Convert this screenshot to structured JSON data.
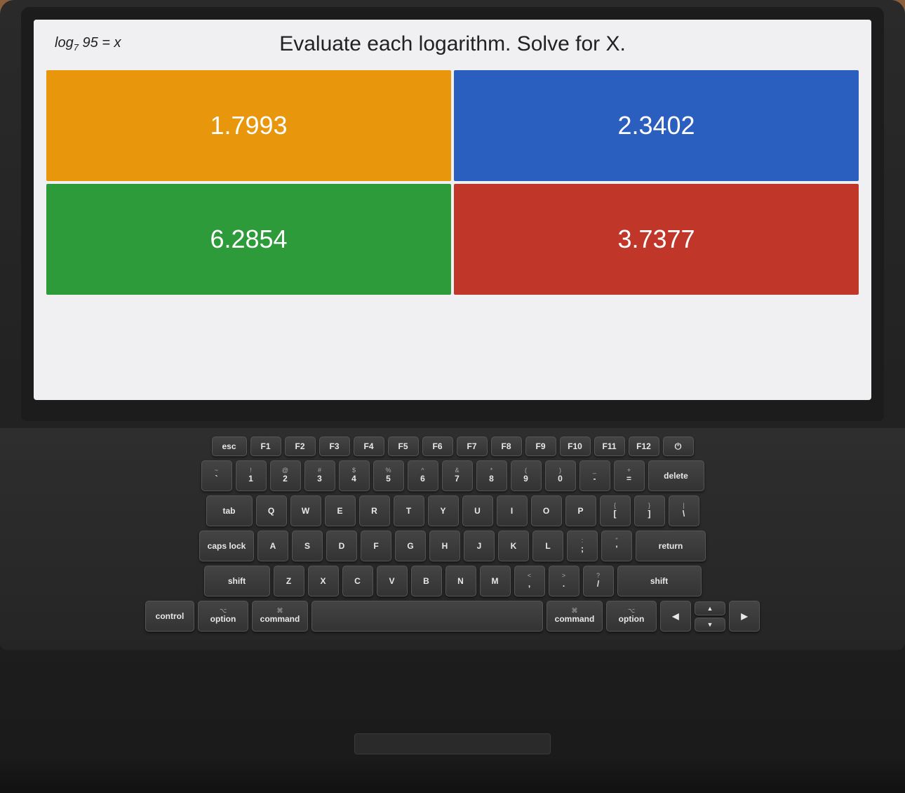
{
  "screen": {
    "math_expression": "log₇ 95 = x",
    "title": "Evaluate each logarithm. Solve for X.",
    "options": [
      {
        "id": "A",
        "value": "1.7993",
        "color_class": "option-orange",
        "color": "#E8960C"
      },
      {
        "id": "B",
        "value": "2.3402",
        "color_class": "option-blue",
        "color": "#2B5FBF"
      },
      {
        "id": "C",
        "value": "6.2854",
        "color_class": "option-green",
        "color": "#2E9B3A"
      },
      {
        "id": "D",
        "value": "3.7377",
        "color_class": "option-red",
        "color": "#C0372A"
      }
    ]
  },
  "keyboard": {
    "fn_row": [
      "esc",
      "F1",
      "F2",
      "F3",
      "F4",
      "F5",
      "F6",
      "F7",
      "F8",
      "F9",
      "F10",
      "F11",
      "F12",
      ""
    ],
    "row1": [
      "~\n`",
      "!\n1",
      "@\n2",
      "#\n3",
      "$\n4",
      "%\n5",
      "^\n6",
      "&\n7",
      "*\n8",
      "(\n9",
      ")\n0",
      "_\n-",
      "+\n=",
      "delete"
    ],
    "row2": [
      "tab",
      "Q",
      "W",
      "E",
      "R",
      "T",
      "Y",
      "U",
      "I",
      "O",
      "P",
      "{\n[",
      "}\n]",
      "|\n\\"
    ],
    "row3": [
      "caps lock",
      "A",
      "S",
      "D",
      "F",
      "G",
      "H",
      "J",
      "K",
      "L",
      ":\n;",
      "\"\n'",
      "return"
    ],
    "row4": [
      "shift",
      "Z",
      "X",
      "C",
      "V",
      "B",
      "N",
      "M",
      "<\n,",
      ">\n.",
      "?\n/",
      "shift"
    ],
    "row5": [
      "control",
      "option",
      "command",
      "",
      "command",
      "option",
      "◀",
      "▼",
      "▶"
    ]
  }
}
